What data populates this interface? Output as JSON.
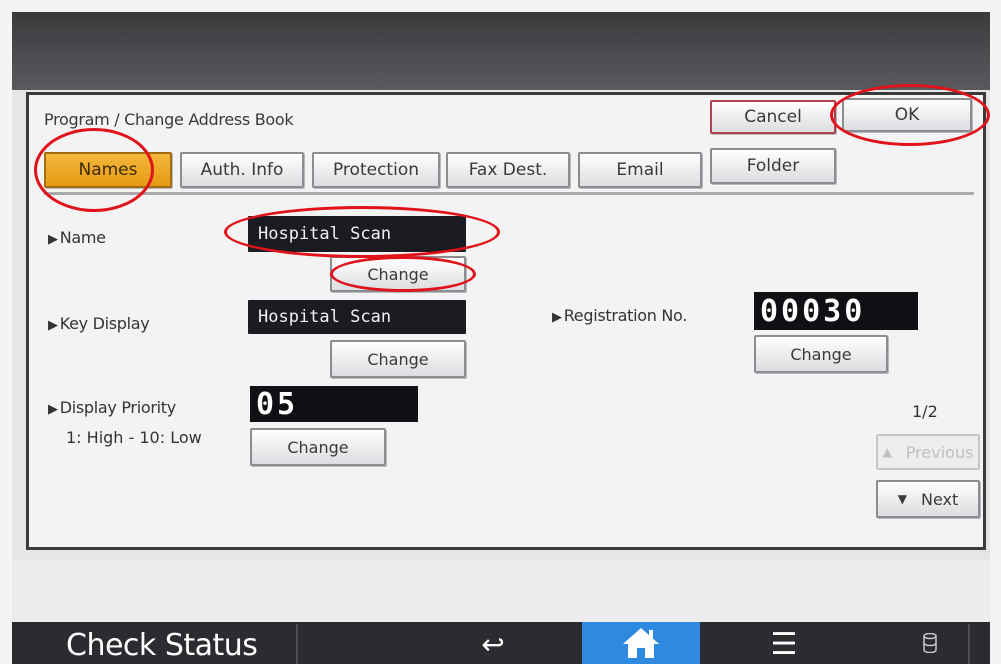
{
  "dialog": {
    "title": "Program / Change Address Book",
    "cancel_label": "Cancel",
    "ok_label": "OK"
  },
  "tabs": [
    {
      "label": "Names",
      "active": true
    },
    {
      "label": "Auth. Info",
      "active": false
    },
    {
      "label": "Protection",
      "active": false
    },
    {
      "label": "Fax Dest.",
      "active": false
    },
    {
      "label": "Email",
      "active": false
    },
    {
      "label": "Folder",
      "active": false
    }
  ],
  "fields": {
    "name": {
      "label": "Name",
      "value": "Hospital Scan",
      "change_label": "Change"
    },
    "key_display": {
      "label": "Key Display",
      "value": "Hospital Scan",
      "change_label": "Change"
    },
    "registration_no": {
      "label": "Registration No.",
      "value": "00030",
      "change_label": "Change"
    },
    "display_priority": {
      "label": "Display Priority",
      "range": "1: High - 10: Low",
      "value": "05",
      "change_label": "Change"
    }
  },
  "pager": {
    "indicator": "1/2",
    "prev_label": "Previous",
    "next_label": "Next"
  },
  "statusbar": {
    "check_status_label": "Check Status"
  },
  "icons": {
    "back": "back-arrow-icon",
    "home": "home-icon",
    "menu": "menu-icon",
    "storage": "storage-icon"
  },
  "colors": {
    "active_tab": "#f4b73a",
    "annotation_red": "#e0121a",
    "home_button": "#2d8ae0"
  }
}
